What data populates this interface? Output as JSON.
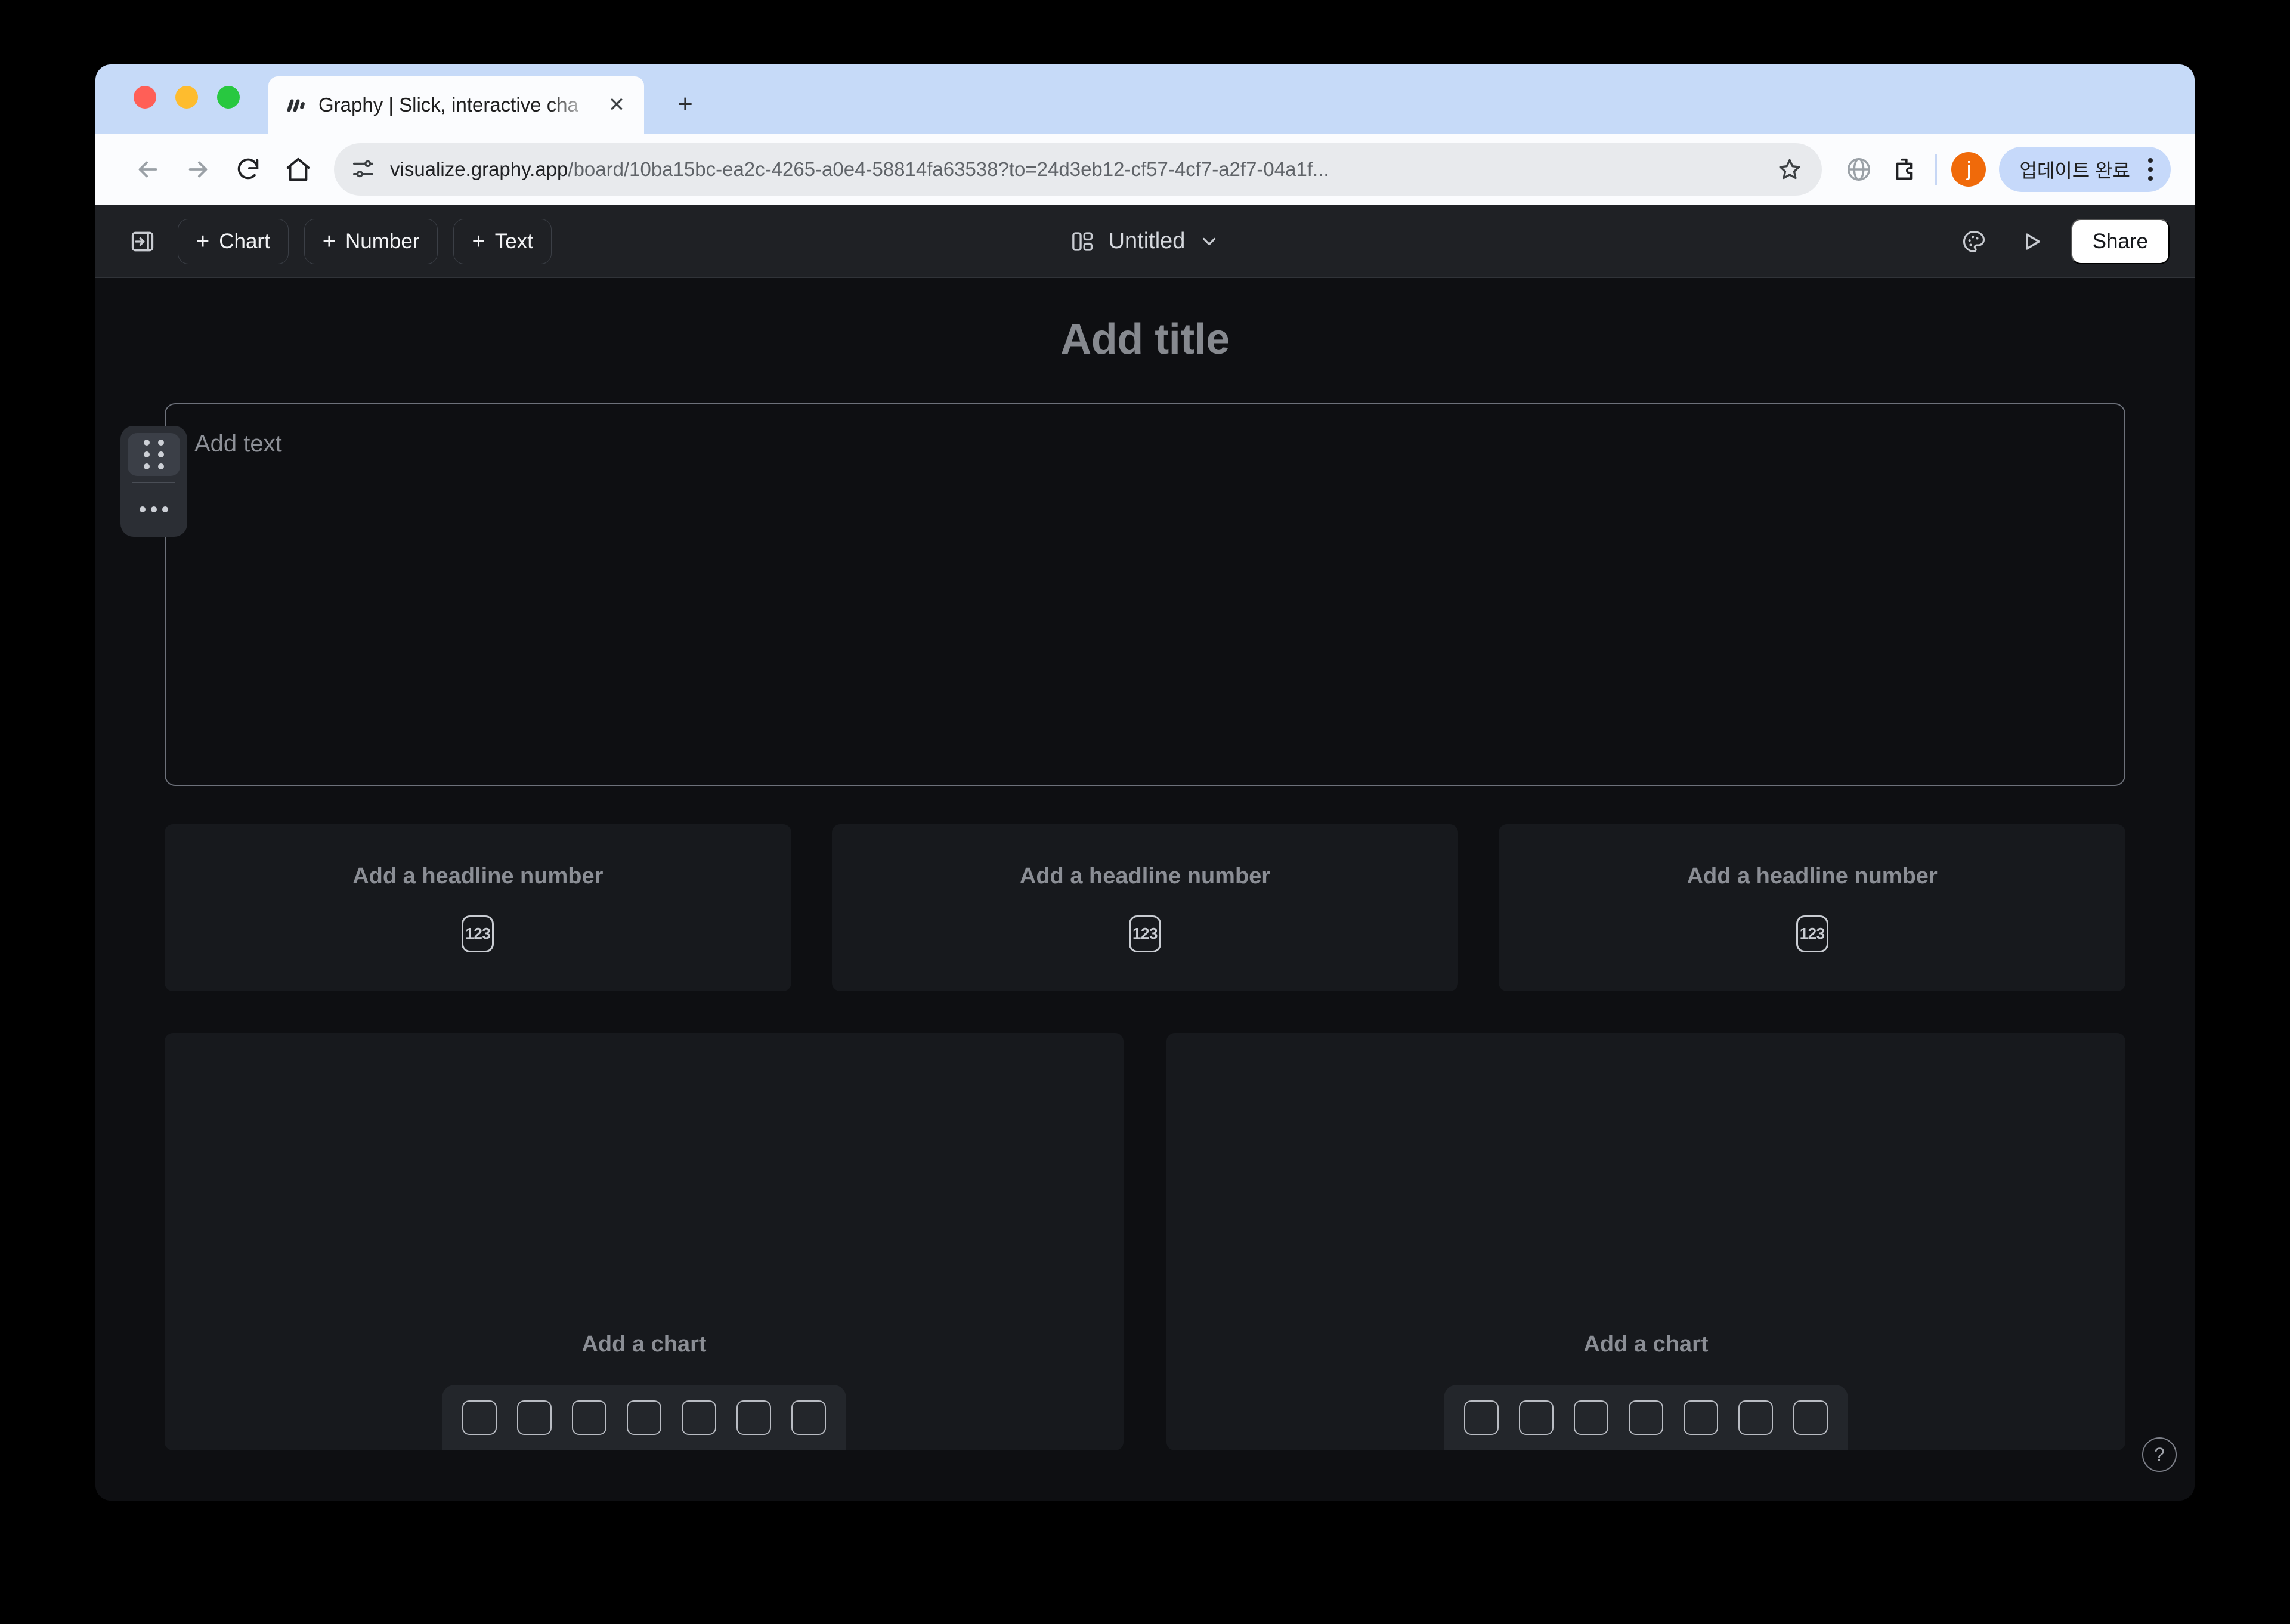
{
  "browser": {
    "tab": {
      "title": "Graphy | Slick, interactive cha",
      "favicon_icon": "graphy-logo-icon",
      "close_icon": "close-icon"
    },
    "new_tab_icon": "plus-icon",
    "nav": {
      "back_icon": "back-arrow-icon",
      "forward_icon": "forward-arrow-icon",
      "reload_icon": "reload-icon",
      "home_icon": "home-icon"
    },
    "omnibox": {
      "site_settings_icon": "page-info-icon",
      "url_domain": "visualize.graphy.app",
      "url_path": "/board/10ba15bc-ea2c-4265-a0e4-58814fa63538?to=24d3eb12-cf57-4cf7-a2f7-04a1f...",
      "bookmark_icon": "star-icon"
    },
    "toolbar_right": {
      "translate_icon": "globe-icon",
      "extensions_icon": "extensions-puzzle-icon",
      "avatar_letter": "j",
      "update_label": "업데이트 완료",
      "menu_icon": "kebab-menu-icon"
    }
  },
  "app": {
    "toolbar": {
      "sidebar_toggle_icon": "sidebar-toggle-icon",
      "add_chart_label": "Chart",
      "add_number_label": "Number",
      "add_text_label": "Text",
      "plus_glyph": "+",
      "layout_icon": "dashboard-layout-icon",
      "doc_title": "Untitled",
      "chevron_icon": "chevron-down-icon",
      "theme_icon": "palette-icon",
      "present_icon": "play-present-icon",
      "share_label": "Share"
    },
    "canvas": {
      "page_title_placeholder": "Add title",
      "text_block": {
        "placeholder": "Add text",
        "drag_handle_icon": "drag-handle-icon",
        "more_icon": "more-horizontal-icon"
      },
      "number_cards": [
        {
          "label": "Add a headline number",
          "icon": "number-123-icon",
          "icon_text": "123"
        },
        {
          "label": "Add a headline number",
          "icon": "number-123-icon",
          "icon_text": "123"
        },
        {
          "label": "Add a headline number",
          "icon": "number-123-icon",
          "icon_text": "123"
        }
      ],
      "chart_cards": [
        {
          "label": "Add a chart",
          "chart_types": [
            "bar-chart-icon",
            "column-chart-icon",
            "stacked-bar-icon",
            "line-chart-icon",
            "area-chart-icon",
            "pie-chart-icon",
            "table-icon"
          ]
        },
        {
          "label": "Add a chart",
          "chart_types": [
            "bar-chart-icon",
            "column-chart-icon",
            "stacked-bar-icon",
            "line-chart-icon",
            "area-chart-icon",
            "pie-chart-icon",
            "table-icon"
          ]
        }
      ],
      "help_label": "?"
    }
  },
  "colors": {
    "tabstrip": "#c6daf8",
    "app_toolbar": "#1f2125",
    "canvas": "#0e0f12",
    "card": "#17191d",
    "accent_avatar": "#f06a0a"
  }
}
